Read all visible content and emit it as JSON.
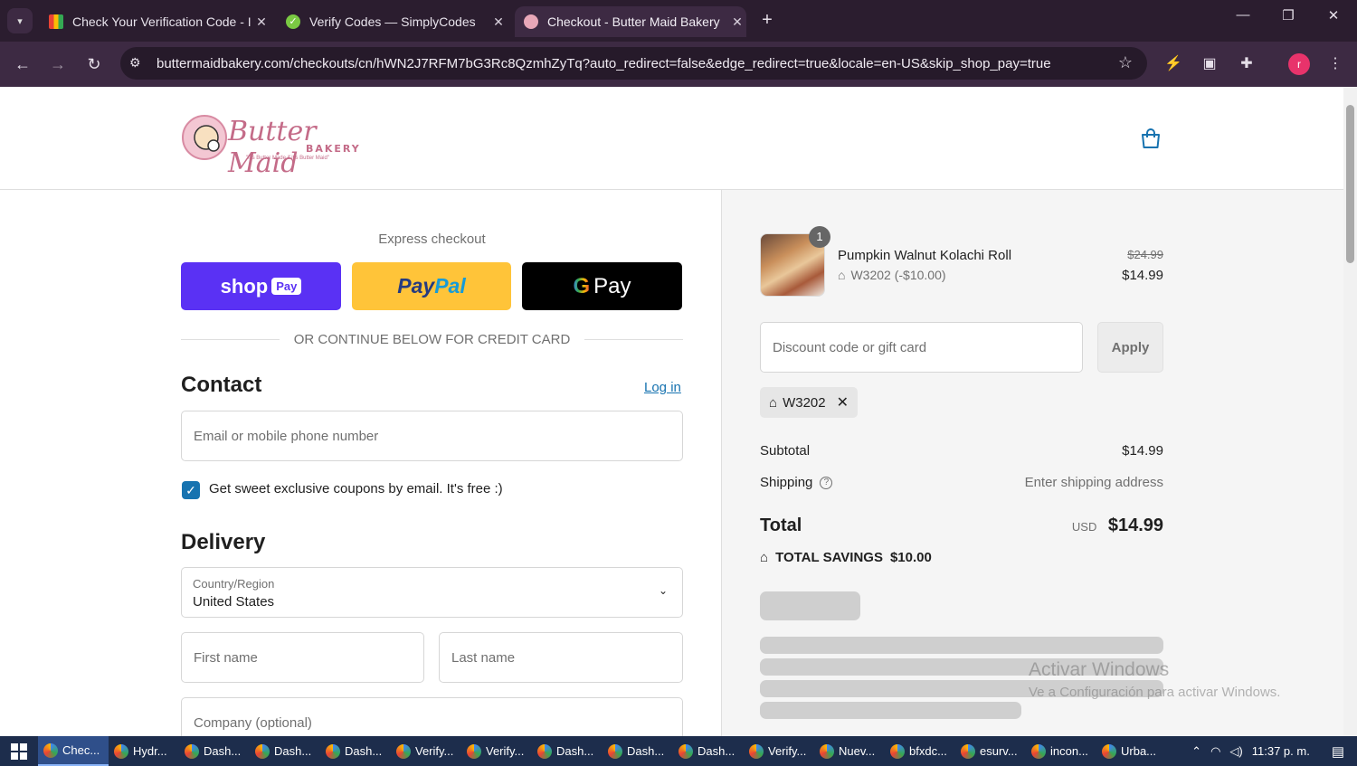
{
  "browser": {
    "tabs": [
      {
        "title": "Check Your Verification Code - I",
        "icon": "gmail-icon",
        "active": false
      },
      {
        "title": "Verify Codes — SimplyCodes",
        "icon": "simplycodes-icon",
        "active": false
      },
      {
        "title": "Checkout - Butter Maid Bakery",
        "icon": "bakery-icon",
        "active": true
      }
    ],
    "url": "buttermaidbakery.com/checkouts/cn/hWN2J7RFM7bG3Rc8QzmhZyTq?auto_redirect=false&edge_redirect=true&locale=en-US&skip_shop_pay=true",
    "profile_initial": "r"
  },
  "store": {
    "logo_text": "Butter Maid",
    "logo_sub": "BAKERY",
    "logo_tag": "\"It's Butter Made if it's Butter Maid\""
  },
  "checkout": {
    "express_label": "Express checkout",
    "shop_pay_label": "shop",
    "shop_pay_badge": "Pay",
    "paypal_label_a": "Pay",
    "paypal_label_b": "Pal",
    "gpay_label": "Pay",
    "or_divider": "OR CONTINUE BELOW FOR CREDIT CARD",
    "contact_heading": "Contact",
    "login_link": "Log in",
    "email_placeholder": "Email or mobile phone number",
    "marketing_checkbox": "Get sweet exclusive coupons by email. It's free :)",
    "delivery_heading": "Delivery",
    "country_label": "Country/Region",
    "country_value": "United States",
    "first_name_placeholder": "First name",
    "last_name_placeholder": "Last name",
    "company_placeholder": "Company (optional)"
  },
  "summary": {
    "item": {
      "quantity": "1",
      "name": "Pumpkin Walnut Kolachi Roll",
      "discount": "W3202 (-$10.00)",
      "original_price": "$24.99",
      "price": "$14.99"
    },
    "discount_placeholder": "Discount code or gift card",
    "apply_label": "Apply",
    "applied_code": "W3202",
    "subtotal_label": "Subtotal",
    "subtotal_value": "$14.99",
    "shipping_label": "Shipping",
    "shipping_value": "Enter shipping address",
    "total_label": "Total",
    "currency": "USD",
    "total_value": "$14.99",
    "savings_label": "TOTAL SAVINGS",
    "savings_value": "$10.00"
  },
  "watermark": {
    "title": "Activar Windows",
    "subtitle": "Ve a Configuración para activar Windows."
  },
  "taskbar": {
    "apps": [
      {
        "label": "Chec...",
        "active": true
      },
      {
        "label": "Hydr...",
        "active": false
      },
      {
        "label": "Dash...",
        "active": false
      },
      {
        "label": "Dash...",
        "active": false
      },
      {
        "label": "Dash...",
        "active": false
      },
      {
        "label": "Verify...",
        "active": false
      },
      {
        "label": "Verify...",
        "active": false
      },
      {
        "label": "Dash...",
        "active": false
      },
      {
        "label": "Dash...",
        "active": false
      },
      {
        "label": "Dash...",
        "active": false
      },
      {
        "label": "Verify...",
        "active": false
      },
      {
        "label": "Nuev...",
        "active": false
      },
      {
        "label": "bfxdc...",
        "active": false
      },
      {
        "label": "esurv...",
        "active": false
      },
      {
        "label": "incon...",
        "active": false
      },
      {
        "label": "Urba...",
        "active": false
      }
    ],
    "time": "11:37 p. m."
  },
  "colors": {
    "accent": "#1773b0",
    "shop_pay": "#5a31f4",
    "paypal": "#ffc439",
    "gpay": "#000000",
    "browser_frame": "#3d2a43"
  }
}
